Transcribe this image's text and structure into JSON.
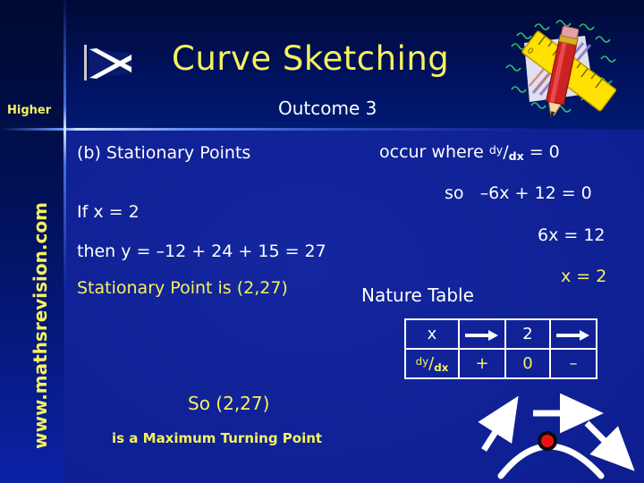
{
  "slide": {
    "title": "Curve Sketching",
    "subtitle": "Outcome 3",
    "level_badge": "Higher",
    "website": "www.mathsrevision.com",
    "colors": {
      "background_header": "#000b3a",
      "background_body": "#1122a0",
      "title_yellow": "#f5f25f",
      "body_white": "#ffffff",
      "marker_red": "#ee1111"
    }
  },
  "left_column": {
    "heading": "(b)  Stationary Points",
    "if_line": "If  x = 2",
    "then_line": "then y = –12 + 24 + 15  =  27",
    "stationary_point": "Stationary Point is (2,27)",
    "conclusion": "So  (2,27)",
    "conclusion_sub": "is a Maximum Turning Point"
  },
  "right_column": {
    "occur_prefix": "occur  where",
    "derivative_num": "dy",
    "derivative_slash": "/",
    "derivative_den": "dx",
    "occur_suffix": "=  0",
    "so_label": "so",
    "equation_1": "–6x + 12  =  0",
    "equation_2": "6x  =  12",
    "equation_3": "x  =  2"
  },
  "nature_table": {
    "label": "Nature Table",
    "rows": [
      {
        "cells": [
          {
            "text": "x",
            "kind": "text",
            "color": "white"
          },
          {
            "text": "",
            "kind": "arrow",
            "color": "white"
          },
          {
            "text": "2",
            "kind": "text",
            "color": "white"
          },
          {
            "text": "",
            "kind": "arrow",
            "color": "white"
          }
        ]
      },
      {
        "cells": [
          {
            "text": "dy/dx",
            "kind": "fraction",
            "color": "yellow"
          },
          {
            "text": "+",
            "kind": "text",
            "color": "yellow"
          },
          {
            "text": "0",
            "kind": "text",
            "color": "yellow"
          },
          {
            "text": "–",
            "kind": "text",
            "color": "yellow"
          }
        ]
      }
    ]
  },
  "icons": {
    "flag": "saltire-flag-icon",
    "clipart": "ruler-and-pencil-clipart",
    "sketch": "maximum-turning-point-sketch"
  }
}
